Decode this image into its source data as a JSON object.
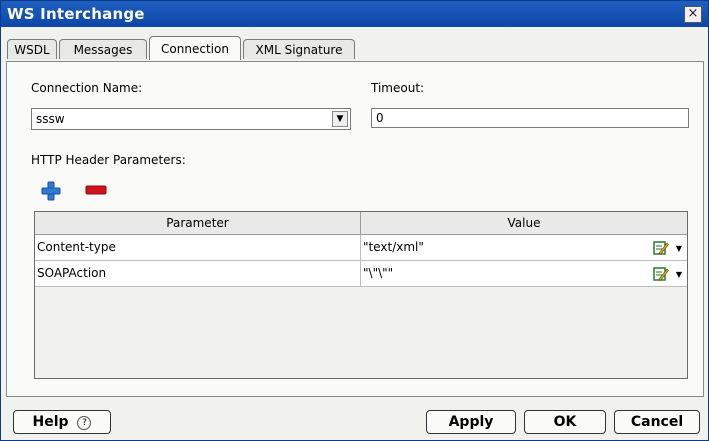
{
  "window": {
    "title": "WS Interchange",
    "close_glyph": "×"
  },
  "tabs": [
    {
      "label": "WSDL"
    },
    {
      "label": "Messages"
    },
    {
      "label": "Connection",
      "active": true
    },
    {
      "label": "XML Signature"
    }
  ],
  "connection": {
    "name_label": "Connection Name:",
    "name_value": "sssw",
    "timeout_label": "Timeout:",
    "timeout_value": "0"
  },
  "http_params": {
    "label": "HTTP Header Parameters:",
    "add_icon": "plus-icon",
    "remove_icon": "minus-icon",
    "columns": [
      "Parameter",
      "Value"
    ],
    "rows": [
      {
        "parameter": "Content-type",
        "value": "\"text/xml\""
      },
      {
        "parameter": "SOAPAction",
        "value": "\"\\\"\\\"\""
      }
    ]
  },
  "buttons": {
    "help": "Help",
    "help_icon": "question-icon",
    "apply": "Apply",
    "ok": "OK",
    "cancel": "Cancel"
  },
  "colors": {
    "titlebar": "#1f5fbf",
    "add_icon": "#2e7bd6",
    "remove_icon": "#d0121a"
  }
}
